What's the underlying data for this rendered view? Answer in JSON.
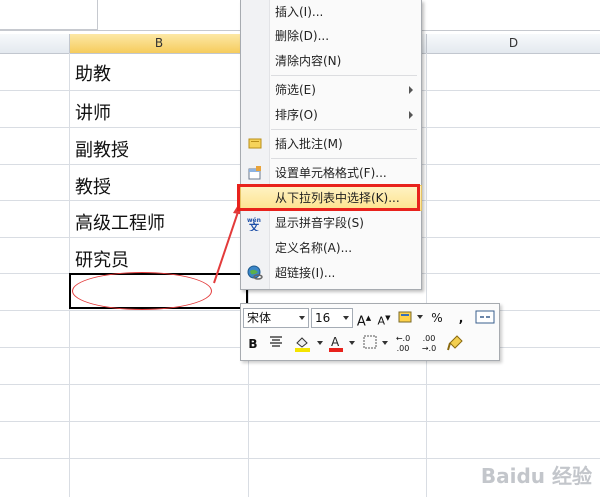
{
  "columns": [
    {
      "label": "B",
      "selected": true
    },
    {
      "label": "D",
      "selected": false
    }
  ],
  "cells": [
    "助教",
    "讲师",
    "副教授",
    "教授",
    "高级工程师",
    "研究员"
  ],
  "context_menu": {
    "items": [
      {
        "label": "插入(I)...",
        "icon": "none"
      },
      {
        "label": "删除(D)...",
        "icon": "none"
      },
      {
        "label": "清除内容(N)",
        "icon": "none"
      },
      {
        "label": "筛选(E)",
        "icon": "none",
        "submenu": true
      },
      {
        "label": "排序(O)",
        "icon": "none",
        "submenu": true
      },
      {
        "label": "插入批注(M)",
        "icon": "comment-icon"
      },
      {
        "label": "设置单元格格式(F)...",
        "icon": "format-cells-icon"
      },
      {
        "label": "从下拉列表中选择(K)...",
        "icon": "none",
        "highlighted": true
      },
      {
        "label": "显示拼音字段(S)",
        "icon": "phonetic-icon"
      },
      {
        "label": "定义名称(A)...",
        "icon": "none"
      },
      {
        "label": "超链接(I)...",
        "icon": "hyperlink-icon"
      }
    ]
  },
  "mini_toolbar": {
    "font_name": "宋体",
    "font_size": "16",
    "percent": "%",
    "comma": ",",
    "bold": "B"
  },
  "colors": {
    "highlight_border": "#e8221c",
    "annotation": "#e33b3b"
  },
  "watermark": "Baidu 经验"
}
